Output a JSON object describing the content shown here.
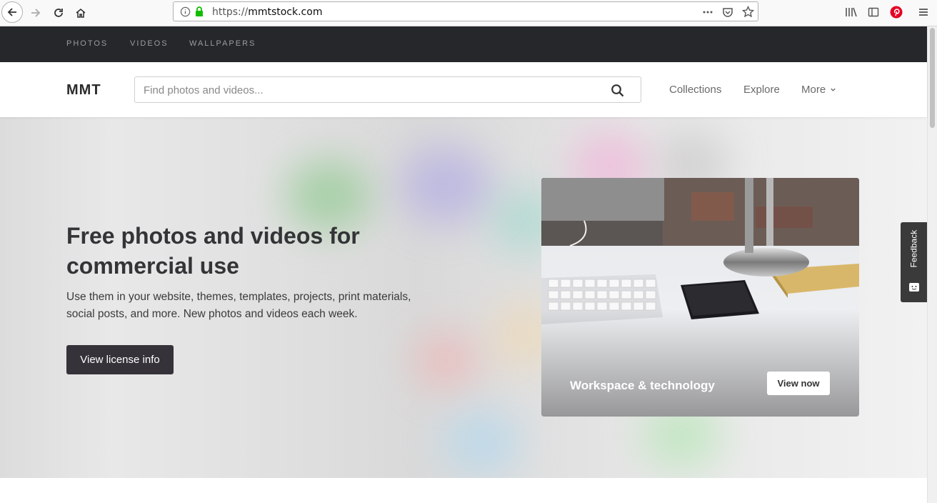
{
  "browser": {
    "url_prefix": "https://",
    "url_host": "mmtstock.com"
  },
  "top_nav": {
    "items": [
      "PHOTOS",
      "VIDEOS",
      "WALLPAPERS"
    ]
  },
  "header": {
    "logo": "MMT",
    "search_placeholder": "Find photos and videos...",
    "nav": [
      "Collections",
      "Explore",
      "More"
    ]
  },
  "hero": {
    "title": "Free photos and videos for commercial use",
    "description": "Use them in your website, themes, templates, projects, print materials, social posts, and more. New photos and videos each week.",
    "license_button": "View license info"
  },
  "card": {
    "title": "Workspace & technology",
    "button": "View now"
  },
  "feedback": {
    "label": "Feedback"
  },
  "colors": {
    "top_nav_bg": "#25272b",
    "button_dark": "#36323a",
    "secure_green": "#12bc00",
    "pinterest_red": "#e60023"
  }
}
